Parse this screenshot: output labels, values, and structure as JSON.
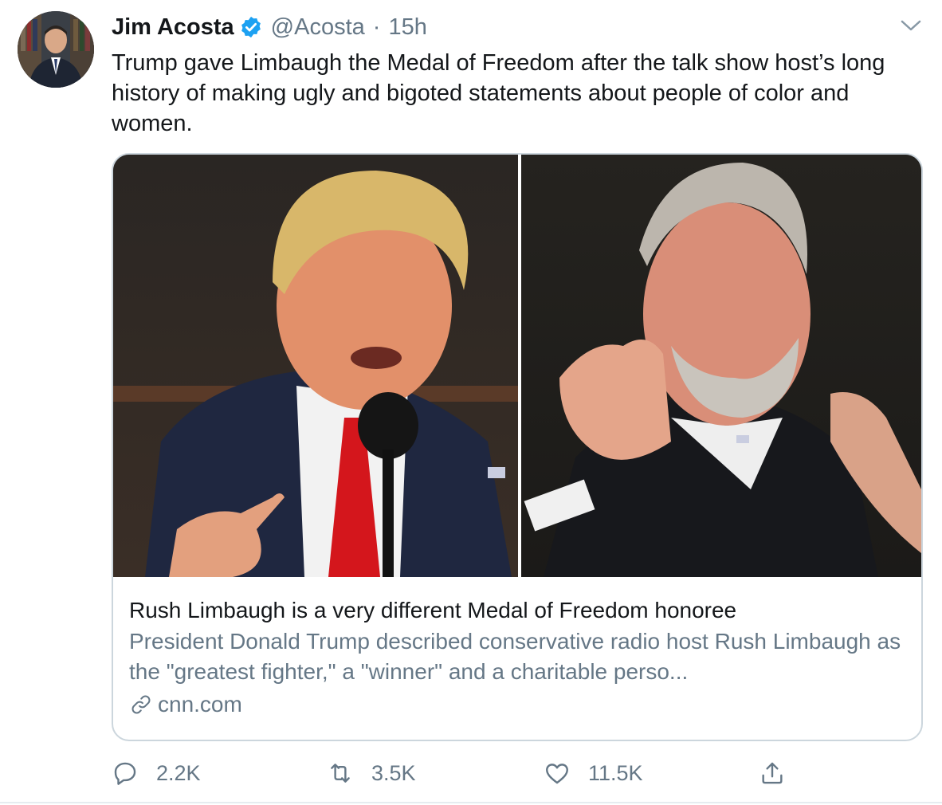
{
  "tweet": {
    "author_name": "Jim Acosta",
    "handle": "@Acosta",
    "separator": "·",
    "time": "15h",
    "text": "Trump gave Limbaugh the Medal of Freedom after the talk show host’s long history of making ugly and bigoted statements about people of color and women.",
    "avatar_icon": "profile-photo",
    "verified_icon": "verified-badge-icon",
    "menu_icon": "chevron-down-icon"
  },
  "card": {
    "title": "Rush Limbaugh is a very different Medal of Freedom honoree",
    "description": "President Donald Trump described conservative radio host Rush Limbaugh as the \"greatest fighter,\" a \"winner\" and a charitable perso...",
    "domain": "cnn.com",
    "domain_icon": "link-icon",
    "image_description_icon": "article-photo"
  },
  "actions": {
    "reply_count": "2.2K",
    "retweet_count": "3.5K",
    "like_count": "11.5K",
    "reply_icon": "reply-icon",
    "retweet_icon": "retweet-icon",
    "like_icon": "heart-icon",
    "share_icon": "share-icon"
  },
  "colors": {
    "text_primary": "#14171a",
    "text_secondary": "#657786",
    "verified_blue": "#1da1f2",
    "border": "#ccd6dd"
  }
}
